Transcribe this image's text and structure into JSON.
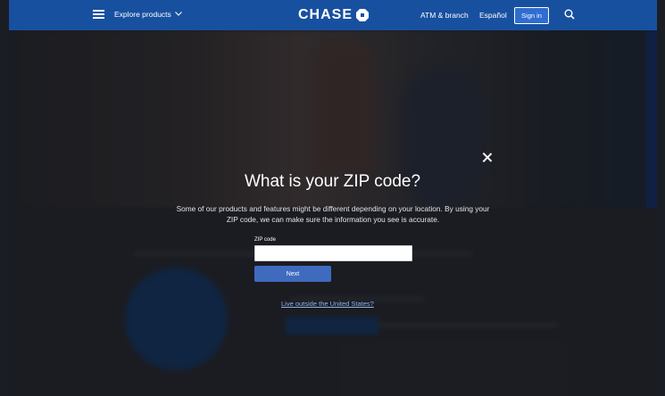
{
  "header": {
    "explore_label": "Explore products",
    "brand": "CHASE",
    "atm_label": "ATM & branch",
    "language_label": "Español",
    "signin_label": "Sign in",
    "color": "#1850a0"
  },
  "dialog": {
    "title": "What is your ZIP code?",
    "description": "Some of our products and features might be different depending on your location. By using your ZIP code, we can make sure the information you see is accurate.",
    "zip_label": "ZIP code",
    "zip_value": "",
    "next_label": "Next",
    "outside_link": "Live outside the United States?"
  },
  "icons": [
    "menu-icon",
    "chevron-down-icon",
    "chase-octagon-icon",
    "search-icon",
    "close-icon"
  ]
}
